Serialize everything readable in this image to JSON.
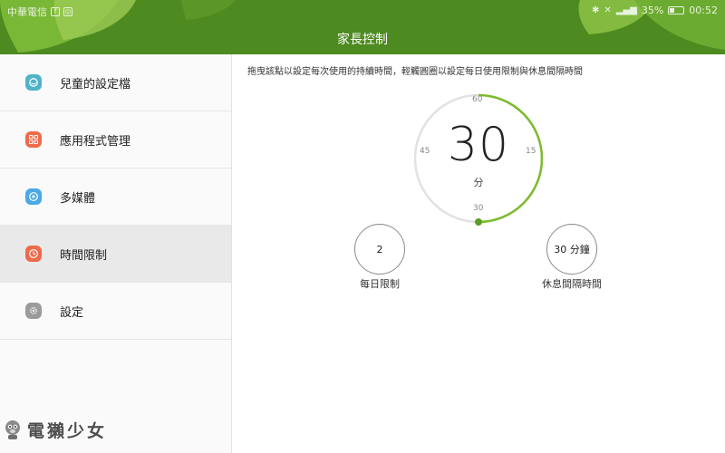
{
  "status_bar": {
    "carrier": "中華電信",
    "battery": "35%",
    "time": "00:52"
  },
  "header": {
    "title": "家長控制"
  },
  "sidebar": {
    "items": [
      {
        "label": "兒童的設定檔",
        "icon": "child-profile-icon",
        "color": "#4fb3c8"
      },
      {
        "label": "應用程式管理",
        "icon": "app-grid-icon",
        "color": "#ef6a4a"
      },
      {
        "label": "多媒體",
        "icon": "media-icon",
        "color": "#4aa9e6"
      },
      {
        "label": "時間限制",
        "icon": "clock-icon",
        "color": "#ef6a4a"
      },
      {
        "label": "設定",
        "icon": "gear-icon",
        "color": "#9b9b9b"
      }
    ],
    "active_index": 3
  },
  "main": {
    "instruction": "拖曳該點以設定每次使用的持續時間，輕觸圓圈以設定每日使用限制與休息間隔時間",
    "dial": {
      "value": "30",
      "unit": "分",
      "ticks": {
        "top": "60",
        "right": "15",
        "bottom": "30",
        "left": "45"
      },
      "fraction": 0.5
    },
    "daily_limit": {
      "value": "2",
      "label": "每日限制"
    },
    "rest_interval": {
      "value": "30 分鐘",
      "label": "休息間隔時間"
    }
  },
  "watermark": {
    "text": "電獺少女"
  },
  "colors": {
    "header_green": "#4d8a1f",
    "accent_green": "#7dbb2e",
    "active_row": "#e9e9e9"
  }
}
